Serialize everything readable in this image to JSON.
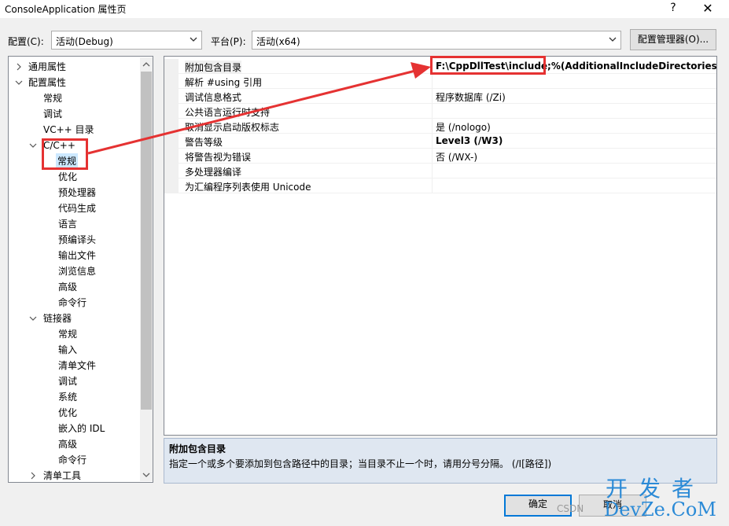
{
  "window": {
    "title": "ConsoleApplication 属性页",
    "help": "?",
    "close": "✕"
  },
  "config": {
    "label": "配置(C):",
    "value": "活动(Debug)"
  },
  "platform": {
    "label": "平台(P):",
    "value": "活动(x64)"
  },
  "config_manager_button": "配置管理器(O)...",
  "tree": {
    "items": [
      {
        "label": "通用属性"
      },
      {
        "label": "配置属性"
      },
      {
        "label": "常规"
      },
      {
        "label": "调试"
      },
      {
        "label": "VC++ 目录"
      },
      {
        "label": "C/C++"
      },
      {
        "label": "常规"
      },
      {
        "label": "优化"
      },
      {
        "label": "预处理器"
      },
      {
        "label": "代码生成"
      },
      {
        "label": "语言"
      },
      {
        "label": "预编译头"
      },
      {
        "label": "输出文件"
      },
      {
        "label": "浏览信息"
      },
      {
        "label": "高级"
      },
      {
        "label": "命令行"
      },
      {
        "label": "链接器"
      },
      {
        "label": "常规"
      },
      {
        "label": "输入"
      },
      {
        "label": "清单文件"
      },
      {
        "label": "调试"
      },
      {
        "label": "系统"
      },
      {
        "label": "优化"
      },
      {
        "label": "嵌入的 IDL"
      },
      {
        "label": "高级"
      },
      {
        "label": "命令行"
      },
      {
        "label": "清单工具"
      }
    ]
  },
  "properties": [
    {
      "name": "附加包含目录",
      "value": "F:\\CppDllTest\\include;%(AdditionalIncludeDirectories)"
    },
    {
      "name": "解析 #using 引用",
      "value": ""
    },
    {
      "name": "调试信息格式",
      "value": "程序数据库 (/Zi)"
    },
    {
      "name": "公共语言运行时支持",
      "value": ""
    },
    {
      "name": "取消显示启动版权标志",
      "value": "是 (/nologo)"
    },
    {
      "name": "警告等级",
      "value": "Level3 (/W3)"
    },
    {
      "name": "将警告视为错误",
      "value": "否 (/WX-)"
    },
    {
      "name": "多处理器编译",
      "value": ""
    },
    {
      "name": "为汇编程序列表使用 Unicode",
      "value": ""
    }
  ],
  "description": {
    "title": "附加包含目录",
    "text": "指定一个或多个要添加到包含路径中的目录；当目录不止一个时，请用分号分隔。      (/I[路径])"
  },
  "buttons": {
    "ok": "确定",
    "cancel": "取消"
  },
  "watermark": {
    "top": "开发者",
    "bottom": "DevZe.CoM",
    "csdn": "CSDN"
  },
  "colors": {
    "accent": "#0078d7",
    "annotation": "#e53232",
    "selection": "#cce8ff"
  }
}
